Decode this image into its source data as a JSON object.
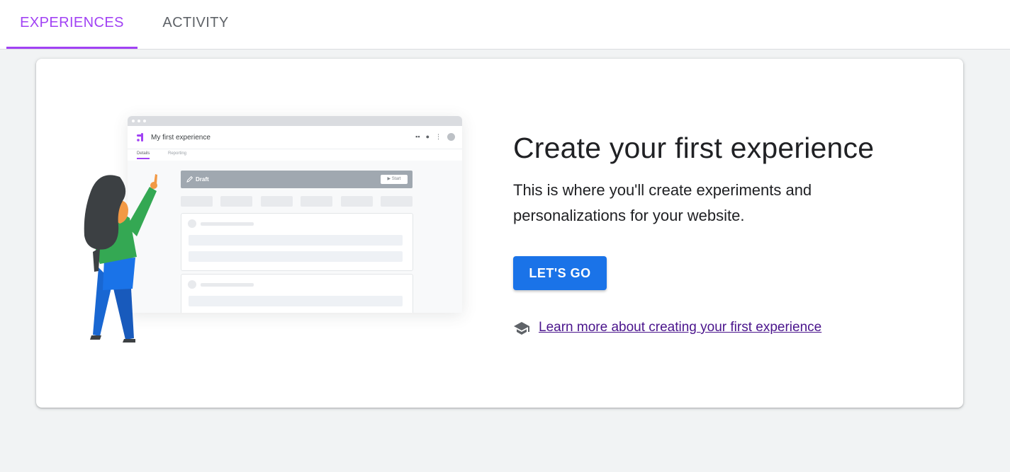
{
  "tabs": [
    {
      "label": "EXPERIENCES",
      "active": true
    },
    {
      "label": "ACTIVITY",
      "active": false
    }
  ],
  "illustration": {
    "window_title": "My first experience",
    "subtabs": [
      "Details",
      "Reporting"
    ],
    "draft_label": "Draft",
    "start_label": "▶ Start"
  },
  "main": {
    "headline": "Create your first experience",
    "description": "This is where you'll create experiments and personalizations for your website.",
    "cta_label": "LET'S GO",
    "learn_more_label": " Learn more about creating your first experience"
  },
  "colors": {
    "accent": "#a142f4",
    "primary_button": "#1a73e8",
    "link": "#4a148c",
    "background": "#f1f3f4"
  },
  "icons": {
    "learn_more": "school-icon",
    "logo": "optimize-logo-icon"
  }
}
